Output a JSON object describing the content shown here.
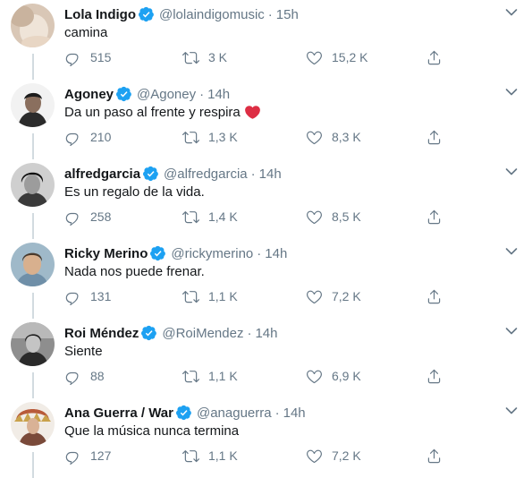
{
  "colors": {
    "text": "#14171a",
    "secondary": "#657786",
    "verified": "#1da1f2",
    "thread_line": "#d2dbe0",
    "heart_emoji": "#dd2e44"
  },
  "icons": {
    "reply": "reply-icon",
    "retweet": "retweet-icon",
    "like": "like-icon",
    "share": "share-icon",
    "verified": "verified-badge-icon",
    "caret": "chevron-down-icon"
  },
  "tweets": [
    {
      "name": "Lola Indigo",
      "handle": "@lolaindigomusic",
      "dot": "·",
      "time": "15h",
      "text": "camina",
      "replies": "515",
      "retweets": "3 K",
      "likes": "15,2 K",
      "emoji": ""
    },
    {
      "name": "Agoney",
      "handle": "@Agoney",
      "dot": "·",
      "time": "14h",
      "text": "Da un paso al frente y respira",
      "replies": "210",
      "retweets": "1,3 K",
      "likes": "8,3 K",
      "emoji": "red-heart"
    },
    {
      "name": "alfredgarcia",
      "handle": "@alfredgarcia",
      "dot": "·",
      "time": "14h",
      "text": "Es un regalo de la vida.",
      "replies": "258",
      "retweets": "1,4 K",
      "likes": "8,5 K",
      "emoji": ""
    },
    {
      "name": "Ricky Merino",
      "handle": "@rickymerino",
      "dot": "·",
      "time": "14h",
      "text": "Nada nos puede frenar.",
      "replies": "131",
      "retweets": "1,1 K",
      "likes": "7,2 K",
      "emoji": ""
    },
    {
      "name": "Roi Méndez",
      "handle": "@RoiMendez",
      "dot": "·",
      "time": "14h",
      "text": "Siente",
      "replies": "88",
      "retweets": "1,1 K",
      "likes": "6,9 K",
      "emoji": ""
    },
    {
      "name": "Ana Guerra / War",
      "handle": "@anaguerra",
      "dot": "·",
      "time": "14h",
      "text": "Que la música nunca termina",
      "replies": "127",
      "retweets": "1,1 K",
      "likes": "7,2 K",
      "emoji": ""
    }
  ]
}
